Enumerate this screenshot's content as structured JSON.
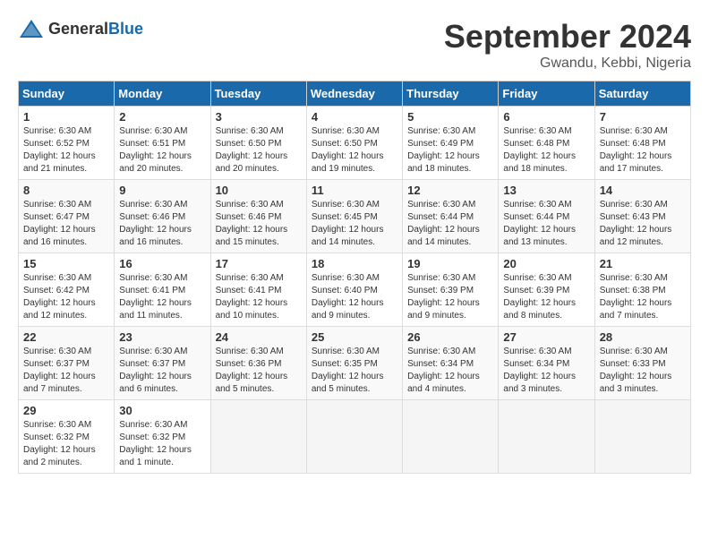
{
  "header": {
    "logo_general": "General",
    "logo_blue": "Blue",
    "month_title": "September 2024",
    "location": "Gwandu, Kebbi, Nigeria"
  },
  "days_of_week": [
    "Sunday",
    "Monday",
    "Tuesday",
    "Wednesday",
    "Thursday",
    "Friday",
    "Saturday"
  ],
  "weeks": [
    [
      {
        "day": "1",
        "sunrise": "6:30 AM",
        "sunset": "6:52 PM",
        "daylight": "12 hours and 21 minutes."
      },
      {
        "day": "2",
        "sunrise": "6:30 AM",
        "sunset": "6:51 PM",
        "daylight": "12 hours and 20 minutes."
      },
      {
        "day": "3",
        "sunrise": "6:30 AM",
        "sunset": "6:50 PM",
        "daylight": "12 hours and 20 minutes."
      },
      {
        "day": "4",
        "sunrise": "6:30 AM",
        "sunset": "6:50 PM",
        "daylight": "12 hours and 19 minutes."
      },
      {
        "day": "5",
        "sunrise": "6:30 AM",
        "sunset": "6:49 PM",
        "daylight": "12 hours and 18 minutes."
      },
      {
        "day": "6",
        "sunrise": "6:30 AM",
        "sunset": "6:48 PM",
        "daylight": "12 hours and 18 minutes."
      },
      {
        "day": "7",
        "sunrise": "6:30 AM",
        "sunset": "6:48 PM",
        "daylight": "12 hours and 17 minutes."
      }
    ],
    [
      {
        "day": "8",
        "sunrise": "6:30 AM",
        "sunset": "6:47 PM",
        "daylight": "12 hours and 16 minutes."
      },
      {
        "day": "9",
        "sunrise": "6:30 AM",
        "sunset": "6:46 PM",
        "daylight": "12 hours and 16 minutes."
      },
      {
        "day": "10",
        "sunrise": "6:30 AM",
        "sunset": "6:46 PM",
        "daylight": "12 hours and 15 minutes."
      },
      {
        "day": "11",
        "sunrise": "6:30 AM",
        "sunset": "6:45 PM",
        "daylight": "12 hours and 14 minutes."
      },
      {
        "day": "12",
        "sunrise": "6:30 AM",
        "sunset": "6:44 PM",
        "daylight": "12 hours and 14 minutes."
      },
      {
        "day": "13",
        "sunrise": "6:30 AM",
        "sunset": "6:44 PM",
        "daylight": "12 hours and 13 minutes."
      },
      {
        "day": "14",
        "sunrise": "6:30 AM",
        "sunset": "6:43 PM",
        "daylight": "12 hours and 12 minutes."
      }
    ],
    [
      {
        "day": "15",
        "sunrise": "6:30 AM",
        "sunset": "6:42 PM",
        "daylight": "12 hours and 12 minutes."
      },
      {
        "day": "16",
        "sunrise": "6:30 AM",
        "sunset": "6:41 PM",
        "daylight": "12 hours and 11 minutes."
      },
      {
        "day": "17",
        "sunrise": "6:30 AM",
        "sunset": "6:41 PM",
        "daylight": "12 hours and 10 minutes."
      },
      {
        "day": "18",
        "sunrise": "6:30 AM",
        "sunset": "6:40 PM",
        "daylight": "12 hours and 9 minutes."
      },
      {
        "day": "19",
        "sunrise": "6:30 AM",
        "sunset": "6:39 PM",
        "daylight": "12 hours and 9 minutes."
      },
      {
        "day": "20",
        "sunrise": "6:30 AM",
        "sunset": "6:39 PM",
        "daylight": "12 hours and 8 minutes."
      },
      {
        "day": "21",
        "sunrise": "6:30 AM",
        "sunset": "6:38 PM",
        "daylight": "12 hours and 7 minutes."
      }
    ],
    [
      {
        "day": "22",
        "sunrise": "6:30 AM",
        "sunset": "6:37 PM",
        "daylight": "12 hours and 7 minutes."
      },
      {
        "day": "23",
        "sunrise": "6:30 AM",
        "sunset": "6:37 PM",
        "daylight": "12 hours and 6 minutes."
      },
      {
        "day": "24",
        "sunrise": "6:30 AM",
        "sunset": "6:36 PM",
        "daylight": "12 hours and 5 minutes."
      },
      {
        "day": "25",
        "sunrise": "6:30 AM",
        "sunset": "6:35 PM",
        "daylight": "12 hours and 5 minutes."
      },
      {
        "day": "26",
        "sunrise": "6:30 AM",
        "sunset": "6:34 PM",
        "daylight": "12 hours and 4 minutes."
      },
      {
        "day": "27",
        "sunrise": "6:30 AM",
        "sunset": "6:34 PM",
        "daylight": "12 hours and 3 minutes."
      },
      {
        "day": "28",
        "sunrise": "6:30 AM",
        "sunset": "6:33 PM",
        "daylight": "12 hours and 3 minutes."
      }
    ],
    [
      {
        "day": "29",
        "sunrise": "6:30 AM",
        "sunset": "6:32 PM",
        "daylight": "12 hours and 2 minutes."
      },
      {
        "day": "30",
        "sunrise": "6:30 AM",
        "sunset": "6:32 PM",
        "daylight": "12 hours and 1 minute."
      },
      null,
      null,
      null,
      null,
      null
    ]
  ]
}
